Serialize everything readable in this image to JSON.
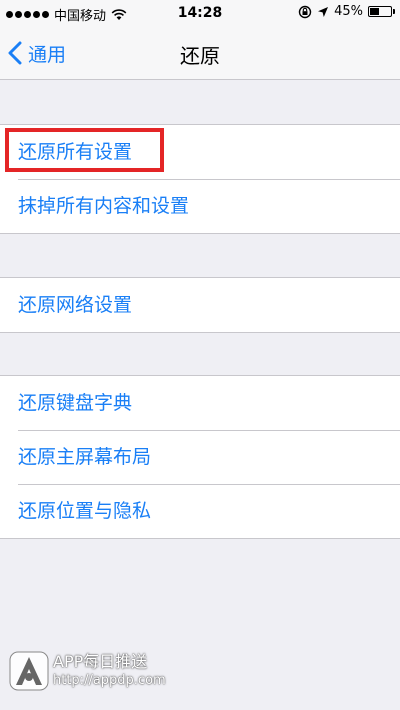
{
  "status_bar": {
    "carrier": "中国移动",
    "time": "14:28",
    "battery_percent": "45%",
    "battery_level": 0.45,
    "icons": [
      "signal-dots-icon",
      "wifi-icon",
      "rotation-lock-icon",
      "location-arrow-icon",
      "battery-icon"
    ]
  },
  "nav": {
    "back_label": "通用",
    "title": "还原"
  },
  "groups": [
    {
      "items": [
        {
          "label": "还原所有设置"
        },
        {
          "label": "抹掉所有内容和设置"
        }
      ]
    },
    {
      "items": [
        {
          "label": "还原网络设置"
        }
      ]
    },
    {
      "items": [
        {
          "label": "还原键盘字典"
        },
        {
          "label": "还原主屏幕布局"
        },
        {
          "label": "还原位置与隐私"
        }
      ]
    }
  ],
  "watermark": {
    "title": "APP每日推送",
    "url": "http://appdp.com"
  },
  "colors": {
    "accent": "#1a7ff6",
    "highlight": "#e42526",
    "background": "#efeff4"
  }
}
